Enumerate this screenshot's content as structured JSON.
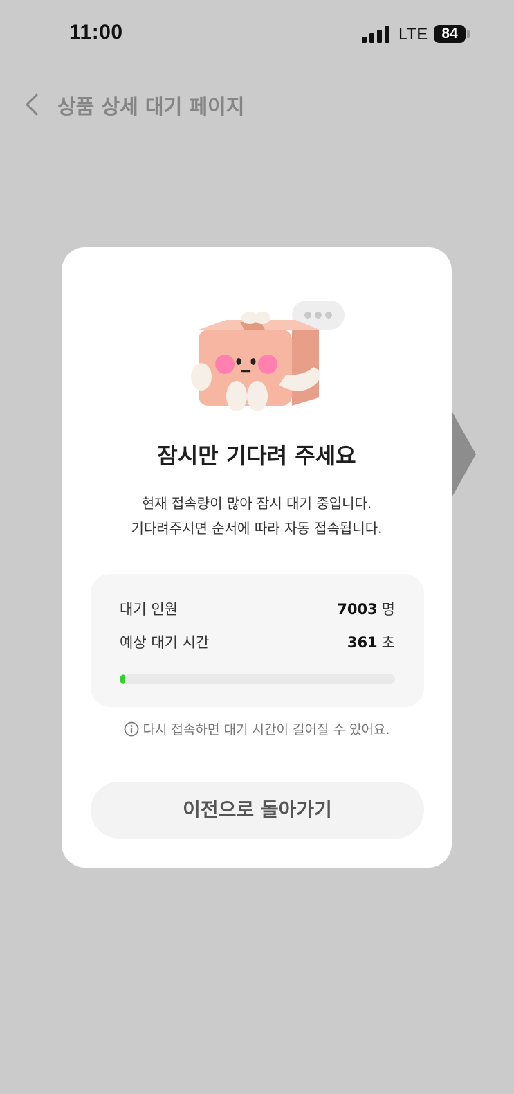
{
  "status_bar": {
    "time": "11:00",
    "network": "LTE",
    "battery": "84",
    "icons": [
      "signal-icon",
      "battery-icon"
    ]
  },
  "nav": {
    "back_icon": "chevron-left-icon",
    "title": "상품 상세 대기 페이지"
  },
  "modal": {
    "illustration": "waiting-box-mascot",
    "title": "잠시만 기다려 주세요",
    "description": [
      "현재 접속량이 많아 잠시 대기 중입니다.",
      "기다려주시면 순서에 따라 자동 접속됩니다."
    ],
    "queue": {
      "people_label": "대기 인원",
      "people_count": "7003",
      "people_unit": "명",
      "time_label": "예상 대기 시간",
      "time_value": "361",
      "time_unit": "초",
      "progress_percent": 1
    },
    "notice_icon": "info-icon",
    "notice": "다시 접속하면 대기 시간이 길어질 수 있어요.",
    "back_button": "이전으로 돌아가기"
  },
  "colors": {
    "page_background": "#cbcbcb",
    "modal_background": "#ffffff",
    "progress_fill": "#33d12a",
    "progress_track": "#eaeaea",
    "nav_title": "#858585"
  }
}
